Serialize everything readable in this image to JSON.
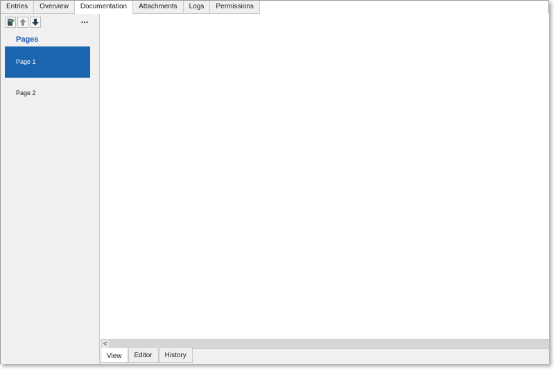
{
  "top_tabs": [
    {
      "label": "Entries"
    },
    {
      "label": "Overview"
    },
    {
      "label": "Documentation"
    },
    {
      "label": "Attachments"
    },
    {
      "label": "Logs"
    },
    {
      "label": "Permissions"
    }
  ],
  "active_top_tab": "Documentation",
  "sidebar": {
    "toolbar": {
      "icons": [
        "edit-page-icon",
        "move-up-icon",
        "move-down-icon"
      ],
      "more_label": "..."
    },
    "pages_title": "Pages",
    "pages": [
      {
        "label": "Page 1",
        "selected": true
      },
      {
        "label": "Page 2",
        "selected": false
      }
    ]
  },
  "scroll": {
    "left_arrow": "<"
  },
  "bottom_tabs": [
    {
      "label": "View"
    },
    {
      "label": "Editor"
    },
    {
      "label": "History"
    }
  ],
  "active_bottom_tab": "View",
  "colors": {
    "accent": "#1a65ad",
    "title_blue": "#1a55b0",
    "sidebar_bg": "#f0f0f0",
    "content_bg": "#ffffff"
  }
}
